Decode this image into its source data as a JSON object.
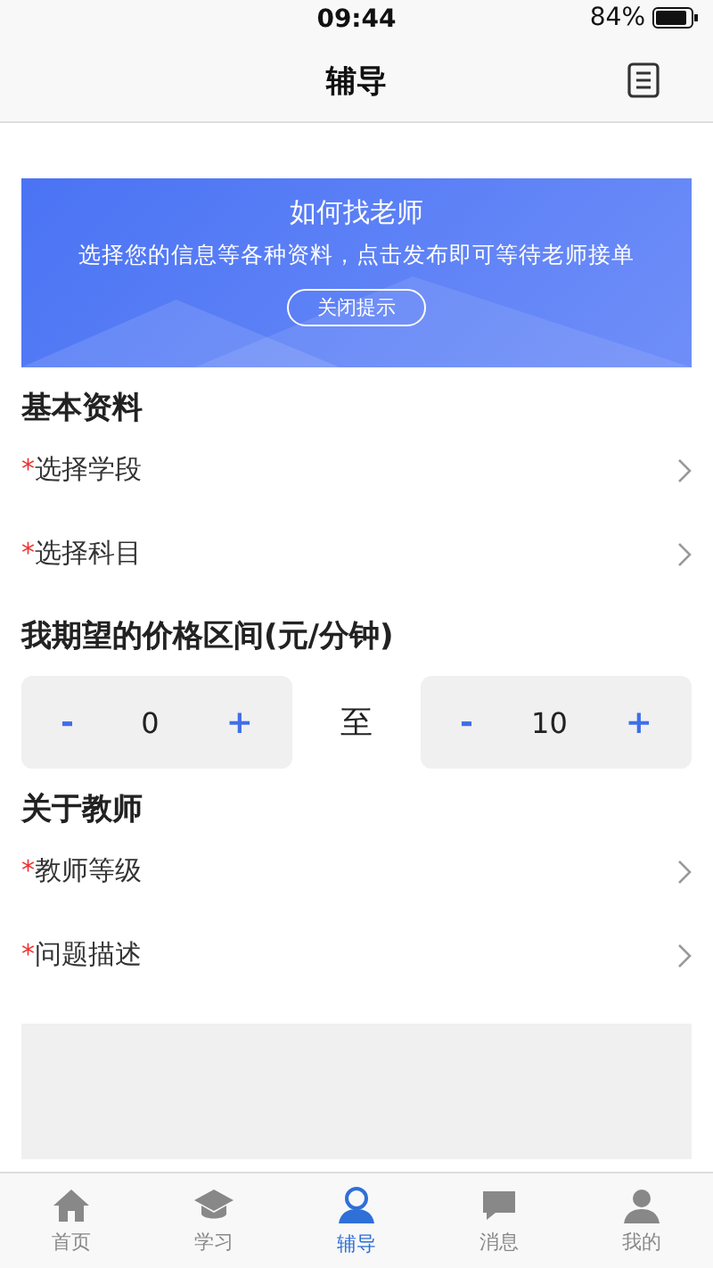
{
  "status_bar": {
    "time": "09:44",
    "battery": "84%"
  },
  "nav": {
    "title": "辅导"
  },
  "banner": {
    "title": "如何找老师",
    "text": "选择您的信息等各种资料，点击发布即可等待老师接单",
    "button": "关闭提示"
  },
  "sections": [
    {
      "heading": "基本资料",
      "kind": "select",
      "rows": [
        {
          "required_mark": "*",
          "label": "选择学段"
        },
        {
          "required_mark": "*",
          "label": "选择科目"
        }
      ]
    },
    {
      "heading": "我期望的价格区间(元/分钟)",
      "kind": "price",
      "min": {
        "minus": "-",
        "value": "0",
        "plus": "+"
      },
      "separator": "至",
      "max": {
        "minus": "-",
        "value": "10",
        "plus": "+"
      }
    },
    {
      "heading": "关于教师",
      "kind": "select",
      "rows": [
        {
          "required_mark": "*",
          "label": "教师等级"
        },
        {
          "required_mark": "*",
          "label": "问题描述"
        }
      ]
    }
  ],
  "tabs": [
    {
      "label": "首页",
      "kind": "home",
      "selected": false
    },
    {
      "label": "学习",
      "kind": "study",
      "selected": false
    },
    {
      "label": "辅导",
      "kind": "tutor",
      "selected": true
    },
    {
      "label": "消息",
      "kind": "message",
      "selected": false
    },
    {
      "label": "我的",
      "kind": "profile",
      "selected": false
    }
  ]
}
